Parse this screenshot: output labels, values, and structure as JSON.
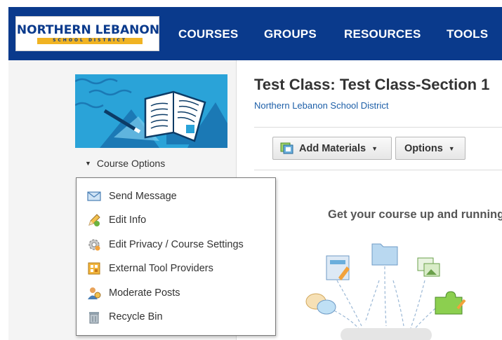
{
  "header": {
    "logo": {
      "main": "NORTHERN LEBANON",
      "sub": "SCHOOL DISTRICT"
    },
    "nav": [
      "COURSES",
      "GROUPS",
      "RESOURCES",
      "TOOLS"
    ]
  },
  "sidebar": {
    "course_options_label": "Course Options",
    "menu": [
      {
        "label": "Send Message",
        "icon": "envelope-icon"
      },
      {
        "label": "Edit Info",
        "icon": "pencil-icon"
      },
      {
        "label": "Edit Privacy / Course Settings",
        "icon": "gear-icon"
      },
      {
        "label": "External Tool Providers",
        "icon": "tool-providers-icon"
      },
      {
        "label": "Moderate Posts",
        "icon": "moderate-user-icon"
      },
      {
        "label": "Recycle Bin",
        "icon": "recycle-bin-icon"
      }
    ]
  },
  "main": {
    "title": "Test Class: Test Class-Section 1",
    "district": "Northern Lebanon School District",
    "add_materials_label": "Add Materials",
    "options_label": "Options",
    "empty_message": "Get your course up and running"
  },
  "colors": {
    "nav_bg": "#0a3a8c",
    "logo_accent": "#f0b323",
    "link": "#1d5fa8",
    "banner": "#2aa3d8"
  }
}
